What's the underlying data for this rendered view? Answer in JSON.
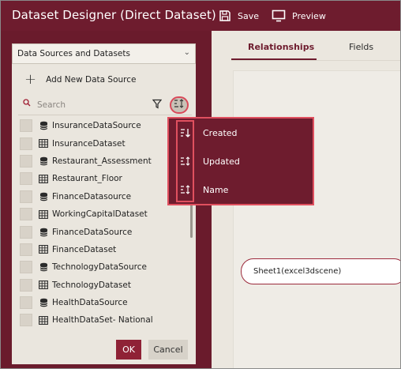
{
  "window": {
    "title": "Dataset Designer  (Direct Dataset)",
    "save_label": "Save",
    "preview_label": "Preview",
    "accent_color": "#6e1c2e"
  },
  "tabs": [
    {
      "label": "Relationships",
      "active": true
    },
    {
      "label": "Fields",
      "active": false
    }
  ],
  "left_panel": {
    "source_select_value": "Data Sources and Datasets",
    "add_new_label": "Add New Data Source",
    "search_placeholder": "Search",
    "items": [
      {
        "label": "InsuranceDataSource",
        "icon": "database-icon"
      },
      {
        "label": "InsuranceDataset",
        "icon": "table-icon"
      },
      {
        "label": "Restaurant_Assessment",
        "icon": "database-icon"
      },
      {
        "label": "Restaurant_Floor",
        "icon": "table-icon"
      },
      {
        "label": "FinanceDatasource",
        "icon": "database-icon"
      },
      {
        "label": "WorkingCapitalDataset",
        "icon": "table-icon"
      },
      {
        "label": "FinanceDataSource",
        "icon": "database-icon"
      },
      {
        "label": "FinanceDataset",
        "icon": "table-icon"
      },
      {
        "label": "TechnologyDataSource",
        "icon": "database-icon"
      },
      {
        "label": "TechnologyDataset",
        "icon": "table-icon"
      },
      {
        "label": "HealthDataSource",
        "icon": "database-icon"
      },
      {
        "label": "HealthDataSet- National",
        "icon": "table-icon"
      }
    ],
    "ok_label": "OK",
    "cancel_label": "Cancel"
  },
  "sort_menu": {
    "items": [
      {
        "label": "Created",
        "icon": "sort-descending-icon"
      },
      {
        "label": "Updated",
        "icon": "sort-icon"
      },
      {
        "label": "Name",
        "icon": "sort-icon"
      }
    ]
  },
  "canvas": {
    "sheet_node_label": "Sheet1(excel3dscene)"
  }
}
